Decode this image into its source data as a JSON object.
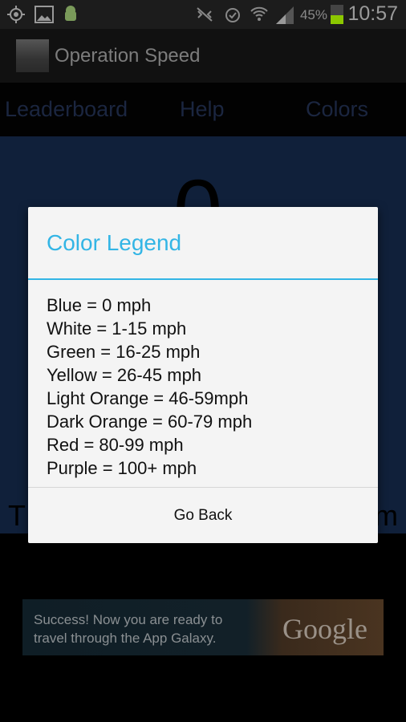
{
  "status_bar": {
    "battery_percent": "45%",
    "time": "10:57",
    "battery_level": 0.45,
    "icons": [
      "gps-icon",
      "gallery-icon",
      "android-icon",
      "mute-icon",
      "alarm-icon",
      "wifi-icon",
      "signal-icon",
      "battery-icon"
    ]
  },
  "action_bar": {
    "title": "Operation Speed"
  },
  "tabs": [
    {
      "label": "Leaderboard"
    },
    {
      "label": "Help"
    },
    {
      "label": "Colors"
    }
  ],
  "background": {
    "speed_value": "0",
    "text_fragment_left": "T",
    "text_fragment_right": "m"
  },
  "dialog": {
    "title": "Color Legend",
    "items": [
      "Blue = 0 mph",
      "White = 1-15 mph",
      "Green = 16-25 mph",
      "Yellow = 26-45 mph",
      "Light Orange = 46-59mph",
      "Dark Orange = 60-79 mph",
      "Red = 80-99 mph",
      "Purple = 100+ mph"
    ],
    "button": "Go Back"
  },
  "ad": {
    "line1": "Success! Now you are ready to",
    "line2": "travel through the App Galaxy.",
    "brand": "Google"
  },
  "colors": {
    "accent": "#33b5e5",
    "background_blue": "#10203a"
  }
}
